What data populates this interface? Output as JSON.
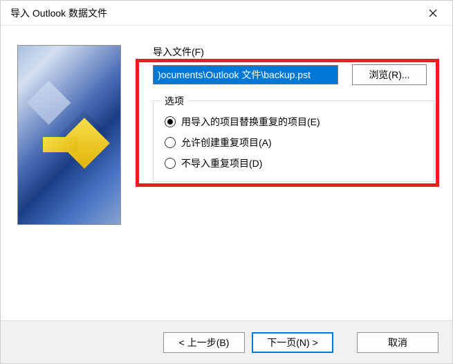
{
  "window": {
    "title": "导入 Outlook 数据文件"
  },
  "import": {
    "file_label": "导入文件(F)",
    "file_value": ")ocuments\\Outlook 文件\\backup.pst",
    "browse_label": "浏览(R)..."
  },
  "options": {
    "legend": "选项",
    "opt1": "用导入的项目替换重复的项目(E)",
    "opt2": "允许创建重复项目(A)",
    "opt3": "不导入重复项目(D)",
    "selected_index": 0
  },
  "footer": {
    "back": "< 上一步(B)",
    "next": "下一页(N) >",
    "cancel": "取消"
  }
}
